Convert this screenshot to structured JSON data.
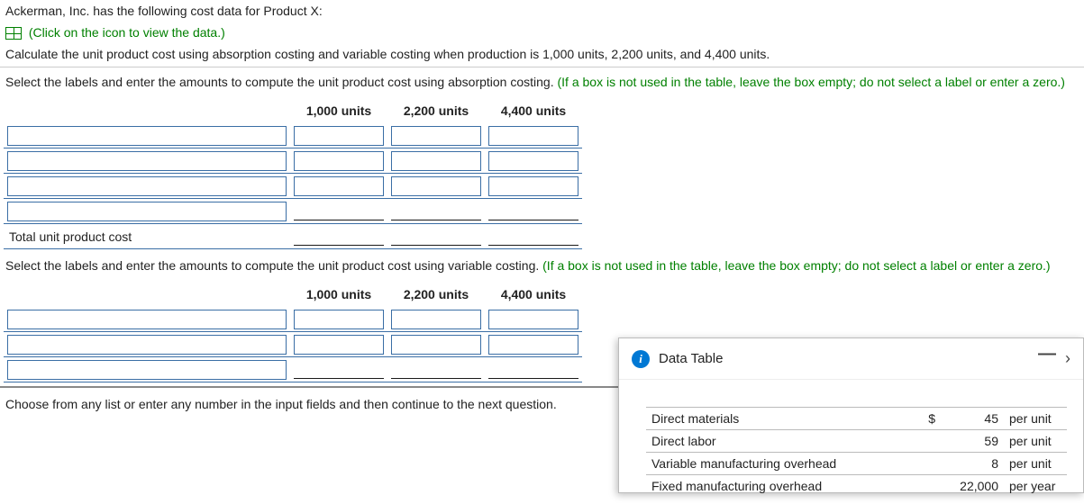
{
  "intro": {
    "line1": "Ackerman, Inc. has the following cost data for Product X:",
    "link_text": "(Click on the icon to view the data.)",
    "line2": "Calculate the unit product cost using absorption costing and variable costing when production is 1,000 units, 2,200 units, and 4,400 units."
  },
  "section1": {
    "instruction_black": "Select the labels and enter the amounts to compute the unit product cost using absorption costing. ",
    "instruction_green": "(If a box is not used in the table, leave the box empty; do not select a label or enter a zero.)",
    "headers": {
      "c1": "1,000 units",
      "c2": "2,200 units",
      "c3": "4,400 units"
    },
    "total_label": "Total unit product cost"
  },
  "section2": {
    "instruction_black": "Select the labels and enter the amounts to compute the unit product cost using variable costing. ",
    "instruction_green": "(If a box is not used in the table, leave the box empty; do not select a label or enter a zero.)",
    "headers": {
      "c1": "1,000 units",
      "c2": "2,200 units",
      "c3": "4,400 units"
    }
  },
  "footer": {
    "text": "Choose from any list or enter any number in the input fields and then continue to the next question."
  },
  "popup": {
    "title": "Data Table",
    "rows": [
      {
        "label": "Direct materials",
        "currency": "$",
        "value": "45",
        "unit": "per unit"
      },
      {
        "label": "Direct labor",
        "currency": "",
        "value": "59",
        "unit": "per unit"
      },
      {
        "label": "Variable manufacturing overhead",
        "currency": "",
        "value": "8",
        "unit": "per unit"
      },
      {
        "label": "Fixed manufacturing overhead",
        "currency": "",
        "value": "22,000",
        "unit": "per year"
      }
    ]
  },
  "chart_data": {
    "type": "table",
    "title": "Data Table",
    "rows": [
      {
        "item": "Direct materials",
        "amount": 45,
        "unit": "per unit"
      },
      {
        "item": "Direct labor",
        "amount": 59,
        "unit": "per unit"
      },
      {
        "item": "Variable manufacturing overhead",
        "amount": 8,
        "unit": "per unit"
      },
      {
        "item": "Fixed manufacturing overhead",
        "amount": 22000,
        "unit": "per year"
      }
    ]
  }
}
